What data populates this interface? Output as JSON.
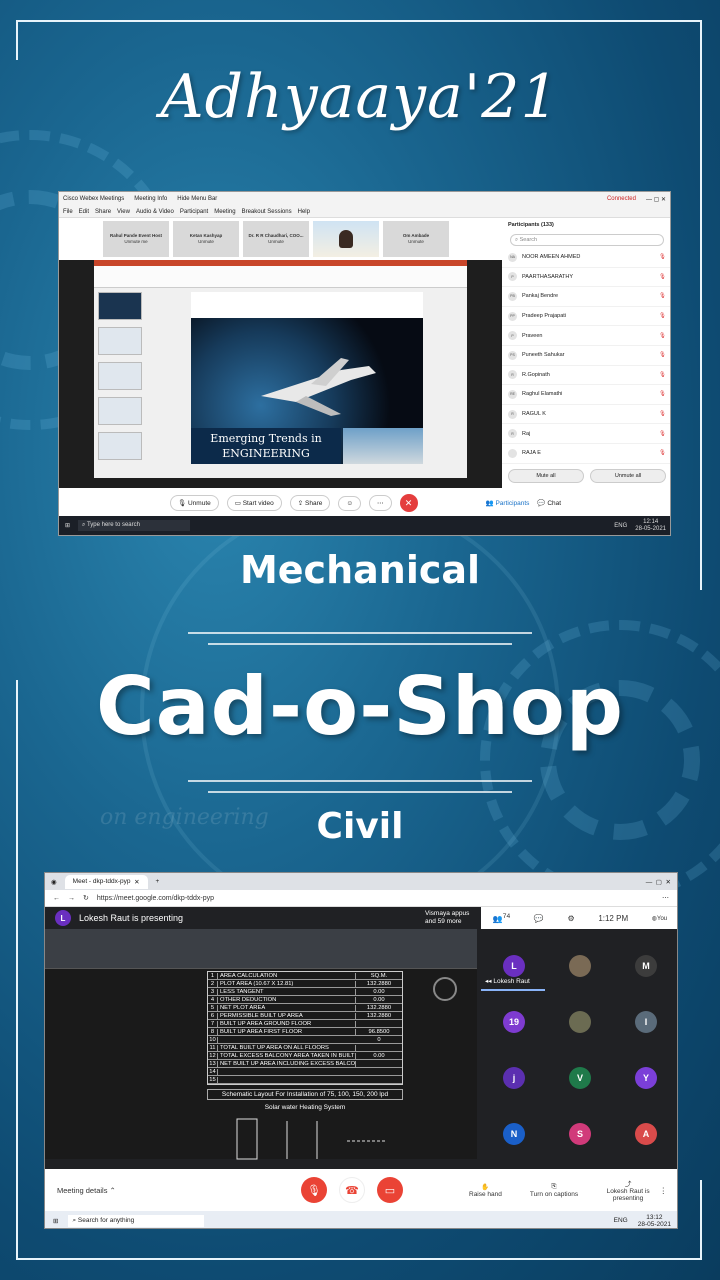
{
  "poster": {
    "title": "Adhyaaya'21",
    "mechanical_label": "Mechanical",
    "main_title": "Cad-o-Shop",
    "civil_label": "Civil",
    "watermark": "on engineering"
  },
  "webex": {
    "app_title": "Cisco Webex Meetings",
    "meeting_info": "Meeting Info",
    "hide_menu": "Hide Menu Bar",
    "connected": "Connected",
    "menu": [
      "File",
      "Edit",
      "Share",
      "View",
      "Audio & Video",
      "Participant",
      "Meeting",
      "Breakout Sessions",
      "Help"
    ],
    "tiles": [
      {
        "name": "Rahul Pande Event Host",
        "sub": "Unmute me"
      },
      {
        "name": "Ketan Kashyap",
        "sub": "Unmute"
      },
      {
        "name": "Dr. R R Chaudhari, COO...",
        "sub": "Unmute"
      },
      {
        "name": "",
        "sub": ""
      },
      {
        "name": "Om Ambade",
        "sub": "Unmute"
      }
    ],
    "participants_title": "Participants (133)",
    "search_placeholder": "Search",
    "participants": [
      {
        "initials": "NA",
        "name": "NOOR AMEEN AHMED"
      },
      {
        "initials": "P",
        "name": "PAARTHASARATHY"
      },
      {
        "initials": "PB",
        "name": "Pankaj Bendre"
      },
      {
        "initials": "PP",
        "name": "Pradeep Prajapati"
      },
      {
        "initials": "P",
        "name": "Praveen"
      },
      {
        "initials": "PS",
        "name": "Puneeth Sahukar"
      },
      {
        "initials": "R",
        "name": "R.Gopinath"
      },
      {
        "initials": "RE",
        "name": "Raghul Elamathi"
      },
      {
        "initials": "R",
        "name": "RAGUL K"
      },
      {
        "initials": "R",
        "name": "Raj"
      },
      {
        "initials": "",
        "name": "RAJA E"
      }
    ],
    "mute_all": "Mute all",
    "unmute_all": "Unmute all",
    "slide_caption_1": "Emerging Trends in",
    "slide_caption_2": "ENGINEERING",
    "controls": {
      "unmute": "Unmute",
      "start_video": "Start video",
      "share": "Share",
      "participants": "Participants",
      "chat": "Chat"
    },
    "taskbar_search": "Type here to search",
    "time": "12:14",
    "date": "28-05-2021",
    "lang": "ENG"
  },
  "meet": {
    "tab_title": "Meet - dkp-tddx-pyp",
    "url": "https://meet.google.com/dkp-tddx-pyp",
    "presenter_initial": "L",
    "presenting": "Lokesh Raut is presenting",
    "other_people": "Vismaya appus and 59 more",
    "people_count": "74",
    "clock": "1:12 PM",
    "you_label": "You",
    "grid_label": "Lokesh Raut",
    "grid_avatars": [
      "L",
      "",
      "M",
      "19",
      "",
      "I",
      "j",
      "V",
      "Y",
      "N",
      "S",
      "A"
    ],
    "cad_rows": [
      {
        "n": "1",
        "t": "AREA CALCULATION",
        "v": "SQ.M."
      },
      {
        "n": "2",
        "t": "PLOT AREA (10.67 X 12.81)",
        "v": "132.2880"
      },
      {
        "n": "3",
        "t": "LESS TANGENT",
        "v": "0.00"
      },
      {
        "n": "4",
        "t": "OTHER DEDUCTION",
        "v": "0.00"
      },
      {
        "n": "5",
        "t": "NET PLOT AREA",
        "v": "132.2880"
      },
      {
        "n": "6",
        "t": "PERMISSIBLE BUILT UP AREA",
        "v": "132.2880"
      },
      {
        "n": "7",
        "t": "BUILT UP AREA GROUND FLOOR",
        "v": ""
      },
      {
        "n": "8",
        "t": "BUILT UP AREA FIRST FLOOR",
        "v": "96.8500"
      },
      {
        "n": "10",
        "t": "",
        "v": "0"
      },
      {
        "n": "11",
        "t": "TOTAL BUILT UP AREA ON ALL FLOORS",
        "v": ""
      },
      {
        "n": "12",
        "t": "TOTAL EXCESS BALCONY AREA TAKEN IN BUILT UP",
        "v": "0.00"
      },
      {
        "n": "13",
        "t": "NET BUILT UP AREA INCLUDING EXCESS BALCONY",
        "v": ""
      },
      {
        "n": "14",
        "t": "",
        "v": ""
      },
      {
        "n": "15",
        "t": "",
        "v": ""
      }
    ],
    "schematic_title": "Schematic Layout For Installation of 75, 100, 150, 200 lpd",
    "solar_title": "Solar water Heating System",
    "meeting_details": "Meeting details",
    "raise_hand": "Raise hand",
    "captions": "Turn on captions",
    "presenting_short": "Lokesh Raut is presenting",
    "taskbar_search": "Search for anything",
    "time": "13:12",
    "date": "28-05-2021",
    "lang": "ENG"
  }
}
